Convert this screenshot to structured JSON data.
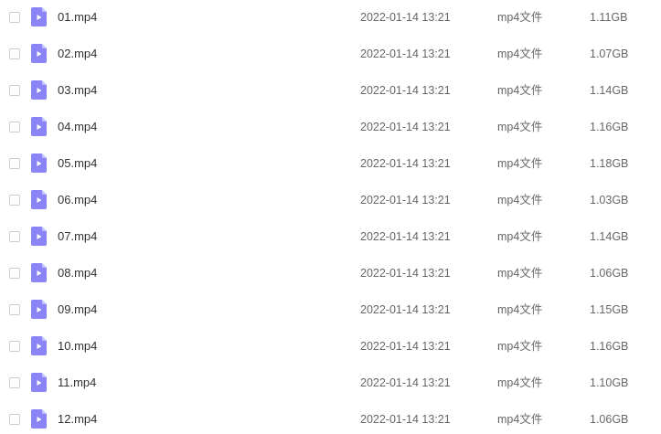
{
  "colors": {
    "icon_body": "#8b84f6",
    "icon_fold": "#c8c4fb",
    "icon_play": "#ffffff",
    "checkbox_border": "#c9ccd2"
  },
  "icons": {
    "file": "video-file-icon",
    "checkbox": "checkbox"
  },
  "files": [
    {
      "name": "01.mp4",
      "date": "2022-01-14 13:21",
      "type": "mp4文件",
      "size": "1.11GB"
    },
    {
      "name": "02.mp4",
      "date": "2022-01-14 13:21",
      "type": "mp4文件",
      "size": "1.07GB"
    },
    {
      "name": "03.mp4",
      "date": "2022-01-14 13:21",
      "type": "mp4文件",
      "size": "1.14GB"
    },
    {
      "name": "04.mp4",
      "date": "2022-01-14 13:21",
      "type": "mp4文件",
      "size": "1.16GB"
    },
    {
      "name": "05.mp4",
      "date": "2022-01-14 13:21",
      "type": "mp4文件",
      "size": "1.18GB"
    },
    {
      "name": "06.mp4",
      "date": "2022-01-14 13:21",
      "type": "mp4文件",
      "size": "1.03GB"
    },
    {
      "name": "07.mp4",
      "date": "2022-01-14 13:21",
      "type": "mp4文件",
      "size": "1.14GB"
    },
    {
      "name": "08.mp4",
      "date": "2022-01-14 13:21",
      "type": "mp4文件",
      "size": "1.06GB"
    },
    {
      "name": "09.mp4",
      "date": "2022-01-14 13:21",
      "type": "mp4文件",
      "size": "1.15GB"
    },
    {
      "name": "10.mp4",
      "date": "2022-01-14 13:21",
      "type": "mp4文件",
      "size": "1.16GB"
    },
    {
      "name": "11.mp4",
      "date": "2022-01-14 13:21",
      "type": "mp4文件",
      "size": "1.10GB"
    },
    {
      "name": "12.mp4",
      "date": "2022-01-14 13:21",
      "type": "mp4文件",
      "size": "1.06GB"
    }
  ]
}
